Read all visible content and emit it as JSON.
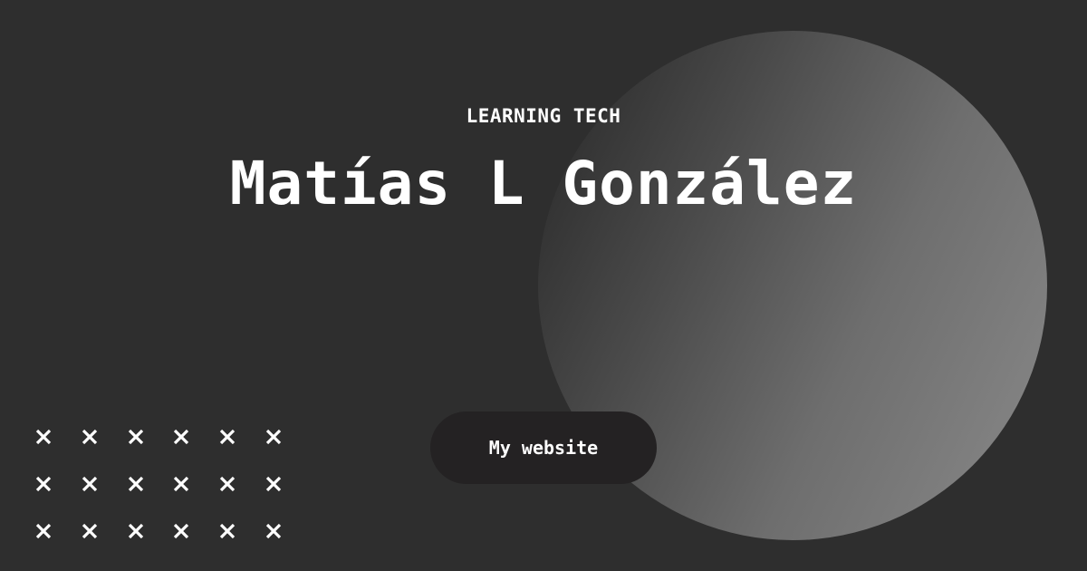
{
  "header": {
    "eyebrow": "LEARNING TECH",
    "name": "Matías L González"
  },
  "cta": {
    "label": "My website"
  },
  "decoration": {
    "cross_icon": "close-icon",
    "cross_rows": 3,
    "cross_cols": 6
  },
  "colors": {
    "background": "#2e2e2e",
    "button": "#242223",
    "text": "#ffffff",
    "circle_light": "#8a8a8a"
  }
}
